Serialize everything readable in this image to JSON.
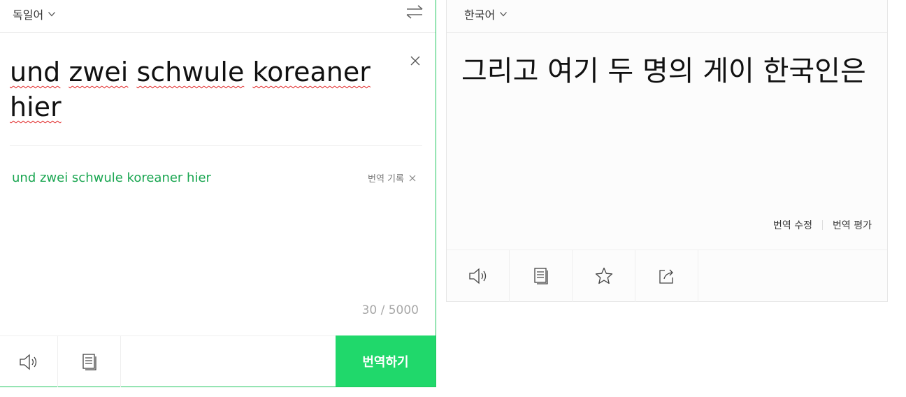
{
  "source": {
    "language": "독일어",
    "text_words": [
      "und",
      "zwei",
      "schwule",
      "koreaner",
      "hier"
    ],
    "suggestion": "und zwei schwule koreaner hier",
    "history_label": "번역 기록",
    "counter": "30 / 5000",
    "translate_button": "번역하기"
  },
  "target": {
    "language": "한국어",
    "text": "그리고 여기 두 명의 게이 한국인은",
    "edit_label": "번역 수정",
    "rate_label": "번역 평가"
  },
  "icons": {
    "chevron": "chevron-down-icon",
    "swap": "swap-arrows-icon",
    "clear": "close-icon",
    "speaker": "speaker-icon",
    "copy": "copy-icon",
    "star": "star-icon",
    "share": "share-icon"
  },
  "colors": {
    "accent": "#20d86b",
    "suggestion": "#1aa651",
    "border_green": "#20c75f"
  }
}
